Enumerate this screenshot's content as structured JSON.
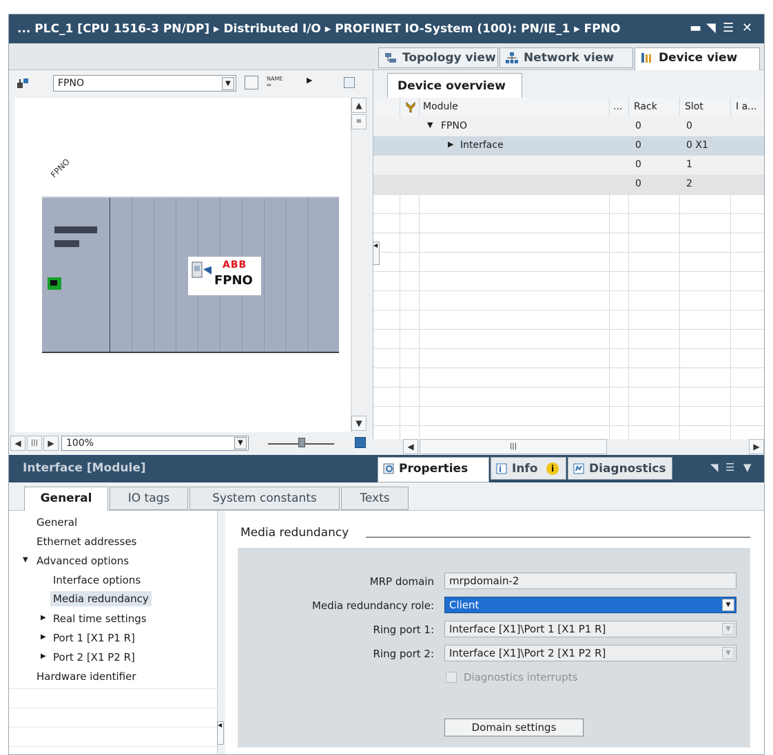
{
  "title_bar": {
    "path": "...   PLC_1 [CPU 1516-3 PN/DP]  ▸  Distributed I/O  ▸  PROFINET IO-System (100): PN/IE_1  ▸  FPNO",
    "controls": [
      "minimize-icon",
      "restore-icon",
      "menu-icon",
      "close-icon"
    ]
  },
  "view_tabs": [
    {
      "label": "Topology view",
      "icon": "topology-icon"
    },
    {
      "label": "Network view",
      "icon": "network-icon"
    },
    {
      "label": "Device view",
      "icon": "device-icon",
      "active": true
    }
  ],
  "left_pane": {
    "device_select": "FPNO",
    "zoom": "100%",
    "device_label": "FPNO",
    "module_logo": "ABB",
    "module_name": "FPNO"
  },
  "device_overview": {
    "tab_label": "Device overview",
    "columns": [
      "Module",
      "...",
      "Rack",
      "Slot",
      "I a..."
    ],
    "rows": [
      {
        "module": "FPNO",
        "rack": "0",
        "slot": "0",
        "expanded": true
      },
      {
        "module": "Interface",
        "rack": "0",
        "slot": "0 X1",
        "expanded": false,
        "selected": true
      },
      {
        "module": "",
        "rack": "0",
        "slot": "1"
      },
      {
        "module": "",
        "rack": "0",
        "slot": "2"
      }
    ]
  },
  "inspector": {
    "title": "Interface [Module]",
    "tabs": [
      {
        "label": "Properties",
        "icon": "properties-icon",
        "active": true
      },
      {
        "label": "Info",
        "icon": "info-icon"
      },
      {
        "label": "Diagnostics",
        "icon": "diagnostics-icon"
      }
    ],
    "subtabs": [
      "General",
      "IO tags",
      "System constants",
      "Texts"
    ]
  },
  "nav": [
    {
      "label": "General",
      "indent": 0
    },
    {
      "label": "Ethernet addresses",
      "indent": 0
    },
    {
      "label": "Advanced options",
      "indent": 0,
      "expanded": true
    },
    {
      "label": "Interface options",
      "indent": 1
    },
    {
      "label": "Media redundancy",
      "indent": 1,
      "selected": true
    },
    {
      "label": "Real time settings",
      "indent": 1,
      "collapsed": true
    },
    {
      "label": "Port 1 [X1 P1 R]",
      "indent": 1,
      "collapsed": true
    },
    {
      "label": "Port 2 [X1 P2 R]",
      "indent": 1,
      "collapsed": true
    },
    {
      "label": "Hardware identifier",
      "indent": 0
    }
  ],
  "media_redundancy": {
    "heading": "Media redundancy",
    "mrp_domain_label": "MRP domain",
    "mrp_domain_value": "mrpdomain-2",
    "role_label": "Media redundancy role:",
    "role_value": "Client",
    "ring_port1_label": "Ring port 1:",
    "ring_port1_value": "Interface [X1]\\Port 1 [X1 P1 R]",
    "ring_port2_label": "Ring port 2:",
    "ring_port2_value": "Interface [X1]\\Port 2 [X1 P2 R]",
    "diag_label": "Diagnostics interrupts",
    "diag_checked": false,
    "domain_button": "Domain settings"
  },
  "colors": {
    "titlebar": "#2f4f6b",
    "accent_select": "#1f6fd1",
    "device_body": "#a5aec0"
  }
}
